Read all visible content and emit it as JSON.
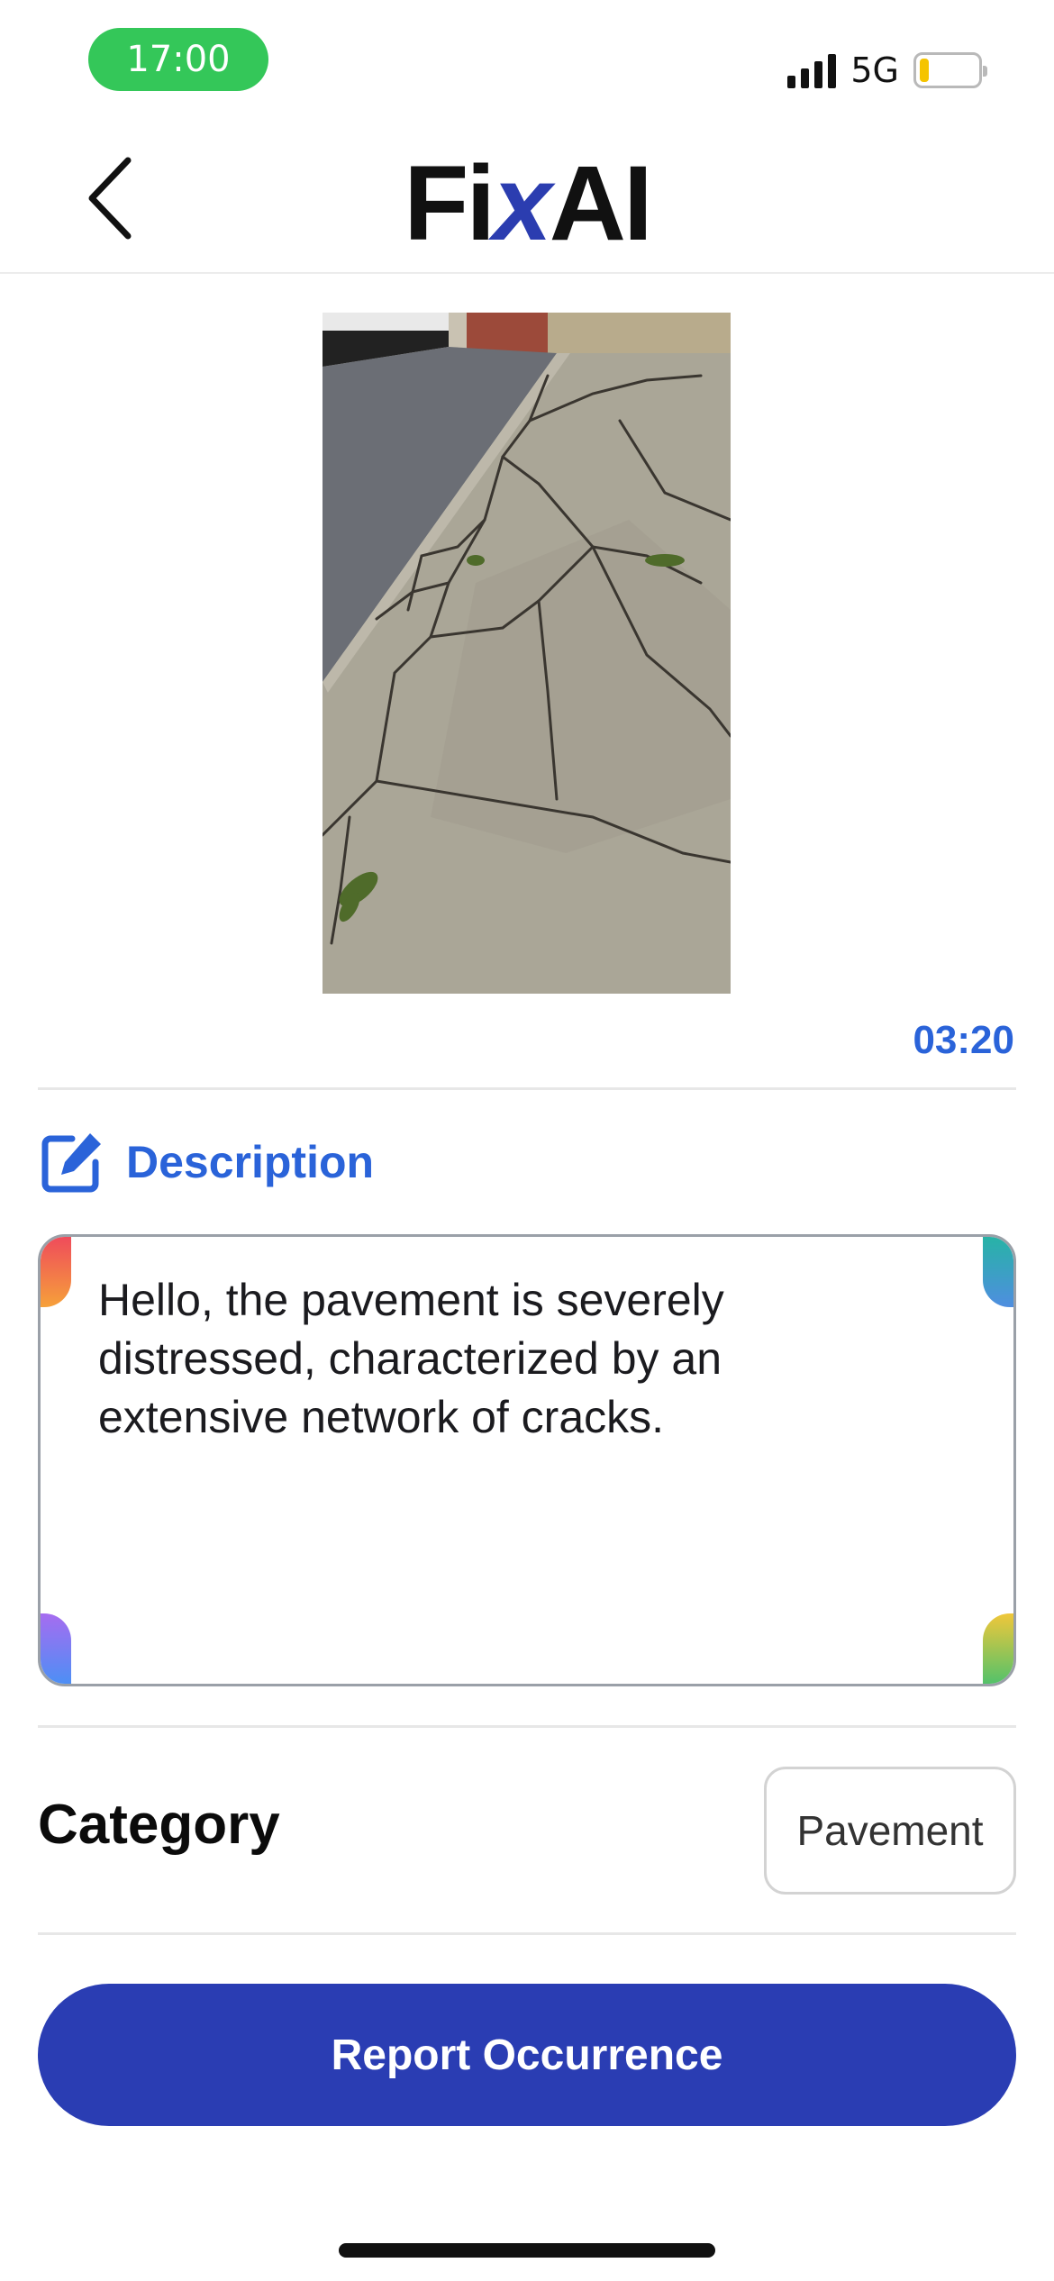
{
  "status_bar": {
    "time": "17:00",
    "network": "5G",
    "signal_bars": 4,
    "battery_level": 0.15,
    "time_pill_color": "#34c759",
    "battery_color": "#f5c400"
  },
  "header": {
    "logo_part1": "Fi",
    "logo_part2": "x",
    "logo_part3": "AI",
    "back_icon": "chevron-left-icon"
  },
  "photo": {
    "subject": "cracked-pavement-photo"
  },
  "media": {
    "duration": "03:20"
  },
  "description": {
    "label": "Description",
    "icon": "edit-icon",
    "text": "Hello, the pavement is severely distressed, characterized by an extensive network of cracks."
  },
  "category": {
    "label": "Category",
    "value": "Pavement"
  },
  "actions": {
    "report_label": "Report Occurrence"
  },
  "colors": {
    "accent": "#2a63d9",
    "primary_button": "#2a3db3"
  }
}
